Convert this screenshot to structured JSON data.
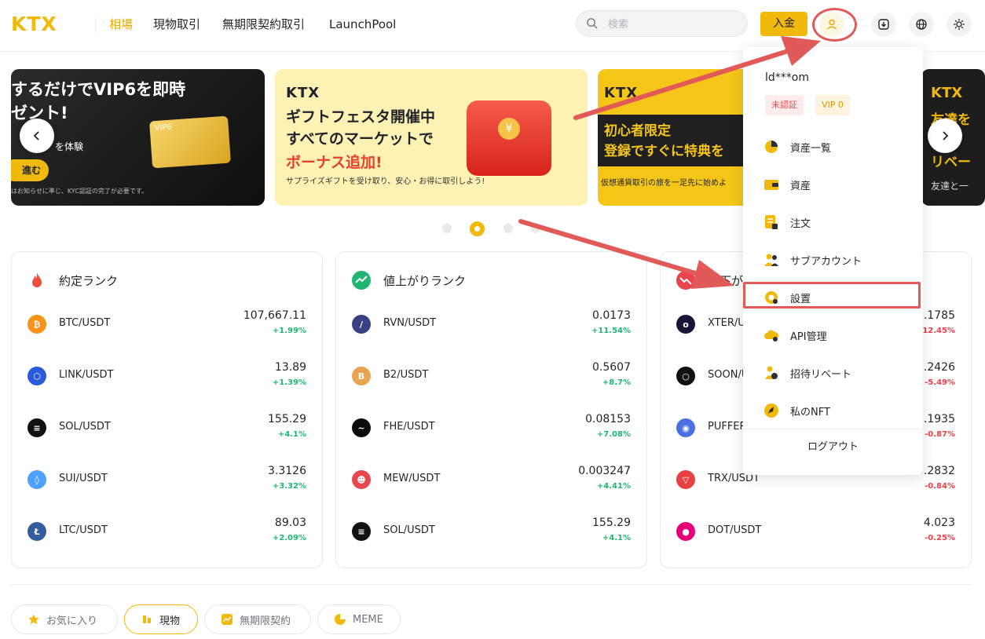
{
  "header": {
    "logo": "KTX",
    "nav": [
      "相場",
      "現物取引",
      "無期限契約取引",
      "LaunchPool"
    ],
    "search_placeholder": "検索",
    "deposit_label": "入金"
  },
  "banners": {
    "b1": {
      "line1": "するだけでVIP6を即時",
      "line2": "ゼント!",
      "line3": "を体験",
      "cta": "進む",
      "note": "はお知らせに準じ、KYC認証の完了が必要です。",
      "card": "VIP6"
    },
    "b2": {
      "logo": "KTX",
      "line1": "ギフトフェスタ開催中",
      "line2": "すべてのマーケットで",
      "line3": "ボーナス追加!",
      "line4": "サプライズギフトを受け取り、安心・お得に取引しよう!"
    },
    "b3": {
      "logo": "KTX",
      "line1": "初心者限定",
      "line2": "登録ですぐに特典を",
      "line3": "仮想通貨取引の旅を一足先に始めよ"
    },
    "b4": {
      "logo": "KTX",
      "line1": "友達を",
      "line2": "リベー",
      "line3": "友達と一"
    }
  },
  "cards": [
    {
      "title": "約定ランク",
      "rows": [
        {
          "pair": "BTC/USDT",
          "price": "107,667.11",
          "change": "+1.99%",
          "dir": "up",
          "coin": "₿",
          "color": "#f7931a"
        },
        {
          "pair": "LINK/USDT",
          "price": "13.89",
          "change": "+1.39%",
          "dir": "up",
          "coin": "⬡",
          "color": "#2a5ada"
        },
        {
          "pair": "SOL/USDT",
          "price": "155.29",
          "change": "+4.1%",
          "dir": "up",
          "coin": "≡",
          "color": "#111111"
        },
        {
          "pair": "SUI/USDT",
          "price": "3.3126",
          "change": "+3.32%",
          "dir": "up",
          "coin": "◊",
          "color": "#4da2ff"
        },
        {
          "pair": "LTC/USDT",
          "price": "89.03",
          "change": "+2.09%",
          "dir": "up",
          "coin": "Ł",
          "color": "#345d9d"
        }
      ]
    },
    {
      "title": "値上がりランク",
      "rows": [
        {
          "pair": "RVN/USDT",
          "price": "0.0173",
          "change": "+11.54%",
          "dir": "up",
          "coin": "/",
          "color": "#384182"
        },
        {
          "pair": "B2/USDT",
          "price": "0.5607",
          "change": "+8.7%",
          "dir": "up",
          "coin": "B",
          "color": "#e8a450"
        },
        {
          "pair": "FHE/USDT",
          "price": "0.08153",
          "change": "+7.08%",
          "dir": "up",
          "coin": "~",
          "color": "#0b0b0b"
        },
        {
          "pair": "MEW/USDT",
          "price": "0.003247",
          "change": "+4.41%",
          "dir": "up",
          "coin": "☻",
          "color": "#e8474f"
        },
        {
          "pair": "SOL/USDT",
          "price": "155.29",
          "change": "+4.1%",
          "dir": "up",
          "coin": "≡",
          "color": "#111111"
        }
      ]
    },
    {
      "title": "値下がりランク",
      "rows": [
        {
          "pair": "XTER/USDT",
          "price": "0.1785",
          "change": "-12.45%",
          "dir": "down",
          "coin": "o",
          "color": "#1a1438"
        },
        {
          "pair": "SOON/USDT",
          "price": "0.2426",
          "change": "-5.49%",
          "dir": "down",
          "coin": "○",
          "color": "#111111"
        },
        {
          "pair": "PUFFER/USDT",
          "price": "0.1935",
          "change": "-0.87%",
          "dir": "down",
          "coin": "◉",
          "color": "#4b6fe4"
        },
        {
          "pair": "TRX/USDT",
          "price": "0.2832",
          "change": "-0.84%",
          "dir": "down",
          "coin": "▽",
          "color": "#e84142"
        },
        {
          "pair": "DOT/USDT",
          "price": "4.023",
          "change": "-0.25%",
          "dir": "down",
          "coin": "●",
          "color": "#e6007a"
        }
      ]
    }
  ],
  "tabs": [
    "お気に入り",
    "現物",
    "無期限契約",
    "MEME"
  ],
  "menu": {
    "username": "ld***om",
    "badge_unverified": "未認証",
    "badge_vip": "VIP 0",
    "items": [
      "資産一覧",
      "資産",
      "注文",
      "サブアカウント",
      "設置",
      "API管理",
      "招待リベート",
      "私のNFT"
    ],
    "logout": "ログアウト"
  },
  "colors": {
    "accent": "#f0b90b",
    "up": "#21b573",
    "down": "#e9434b",
    "annotation": "#e25a57"
  }
}
